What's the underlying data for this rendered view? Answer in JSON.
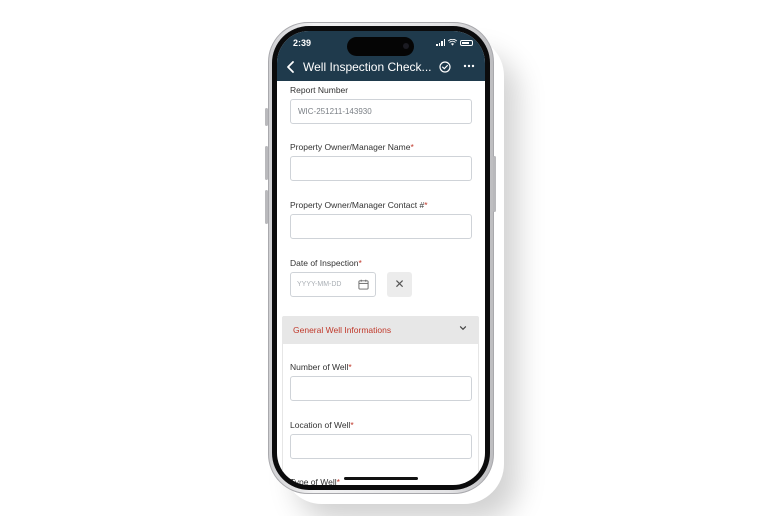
{
  "status_bar": {
    "time": "2:39"
  },
  "header": {
    "title": "Well Inspection Check..."
  },
  "form": {
    "report_number": {
      "label": "Report Number",
      "value": "WIC-251211-143930"
    },
    "owner_name": {
      "label": "Property Owner/Manager Name",
      "required_mark": "*",
      "value": ""
    },
    "owner_contact": {
      "label": "Property Owner/Manager Contact #",
      "required_mark": "*",
      "value": ""
    },
    "inspection_date": {
      "label": "Date of Inspection",
      "required_mark": "*",
      "placeholder": "YYYY-MM-DD"
    },
    "clear_label": "✕"
  },
  "section": {
    "title": "General Well Informations",
    "fields": {
      "number_of_well": {
        "label": "Number of Well",
        "required_mark": "*",
        "value": ""
      },
      "location_of_well": {
        "label": "Location of Well",
        "required_mark": "*",
        "value": ""
      },
      "type_of_well": {
        "label": "Type of Well",
        "required_mark": "*"
      }
    }
  },
  "icons": {
    "back": "chevron-left-icon",
    "check": "check-circle-icon",
    "more": "more-horizontal-icon",
    "calendar": "calendar-icon",
    "clear": "close-icon",
    "section_toggle": "chevron-down-icon"
  },
  "colors": {
    "header_bg": "#1f3a4c",
    "accent_red": "#c0392b",
    "section_bg": "#e7e7e7"
  }
}
